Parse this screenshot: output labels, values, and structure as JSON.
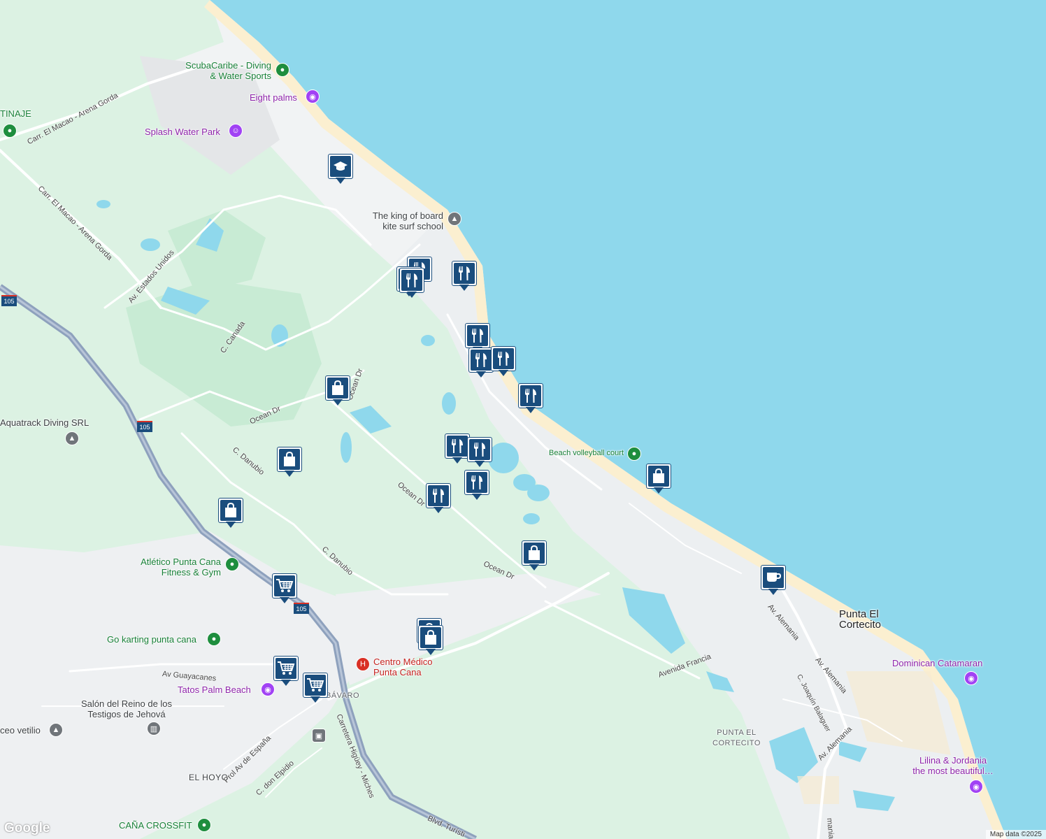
{
  "colors": {
    "water": "#8fd8ec",
    "land": "#f1f3f4",
    "park": "#dcf2e3",
    "road": "#ffffff",
    "highway": "#8ea1bd",
    "beach": "#fbefd0",
    "pin": "#1a4d7d"
  },
  "places": [
    {
      "name": "ScubaCaribe - Diving\n& Water Sports",
      "type": "green"
    },
    {
      "name": "Eight palms",
      "type": "purple"
    },
    {
      "name": "Splash Water Park",
      "type": "purple"
    },
    {
      "name": "The king of board\nkite surf school",
      "type": "gray"
    },
    {
      "name": "Aquatrack Diving SRL",
      "type": "gray"
    },
    {
      "name": "Beach volleyball court",
      "type": "green"
    },
    {
      "name": "Atlético Punta Cana\nFitness & Gym",
      "type": "green"
    },
    {
      "name": "Go karting punta cana",
      "type": "green"
    },
    {
      "name": "Centro Médico\nPunta Cana",
      "type": "red"
    },
    {
      "name": "Tatos Palm Beach",
      "type": "purple"
    },
    {
      "name": "Salón del Reino de los\nTestigos de Jehová",
      "type": "gray"
    },
    {
      "name": "ceo vetilio",
      "type": "gray"
    },
    {
      "name": "CAÑA CROSSFIT",
      "type": "green"
    },
    {
      "name": "Dominican Catamaran",
      "type": "purple"
    },
    {
      "name": "Lilina & Jordania\nthe most beautiful…",
      "type": "purple"
    },
    {
      "name": "TINAJE",
      "type": "green"
    }
  ],
  "areas": {
    "punta_el_cortecito": "Punta El\nCortecito",
    "punta_el_cortecito_small": "PUNTA EL\nCORTECITO",
    "el_hoyo": "EL HOYO",
    "bavaro": "BÁVARO"
  },
  "roads": [
    "Carr. El Macao - Arena Gorda",
    "Carr. El Macao - Arena Gorda",
    "Av. Estados Unidos",
    "C. Canada",
    "Ocean Dr",
    "Ocean Dr",
    "Ocean Dr",
    "Ocean Dr",
    "C. Danubio",
    "C. Danubio",
    "Av Guayacanes",
    "Prol Av de España",
    "C. don Elpidio",
    "Carretera Higüey - Miches",
    "Blvd. Turísti",
    "Avenida Francia",
    "Av. Alemania",
    "Av. Alemania",
    "Av. Alemania",
    "C. Joaquín Balaguer",
    "mania"
  ],
  "highway_shield": "105",
  "pins": [
    {
      "icon": "school-icon"
    },
    {
      "icon": "restaurant-icon"
    },
    {
      "icon": "restaurant-icon"
    },
    {
      "icon": "restaurant-icon"
    },
    {
      "icon": "restaurant-icon"
    },
    {
      "icon": "restaurant-icon"
    },
    {
      "icon": "restaurant-icon"
    },
    {
      "icon": "restaurant-icon"
    },
    {
      "icon": "restaurant-icon"
    },
    {
      "icon": "restaurant-icon"
    },
    {
      "icon": "restaurant-icon"
    },
    {
      "icon": "restaurant-icon"
    },
    {
      "icon": "restaurant-icon"
    },
    {
      "icon": "shopping-bag-icon"
    },
    {
      "icon": "shopping-bag-icon"
    },
    {
      "icon": "shopping-bag-icon"
    },
    {
      "icon": "shopping-bag-icon"
    },
    {
      "icon": "shopping-bag-icon"
    },
    {
      "icon": "shopping-bag-icon"
    },
    {
      "icon": "shopping-bag-icon"
    },
    {
      "icon": "cart-icon"
    },
    {
      "icon": "cart-icon"
    },
    {
      "icon": "cart-icon"
    },
    {
      "icon": "coffee-icon"
    }
  ],
  "branding": {
    "logo": "Google",
    "attribution": "Map data ©2025"
  }
}
